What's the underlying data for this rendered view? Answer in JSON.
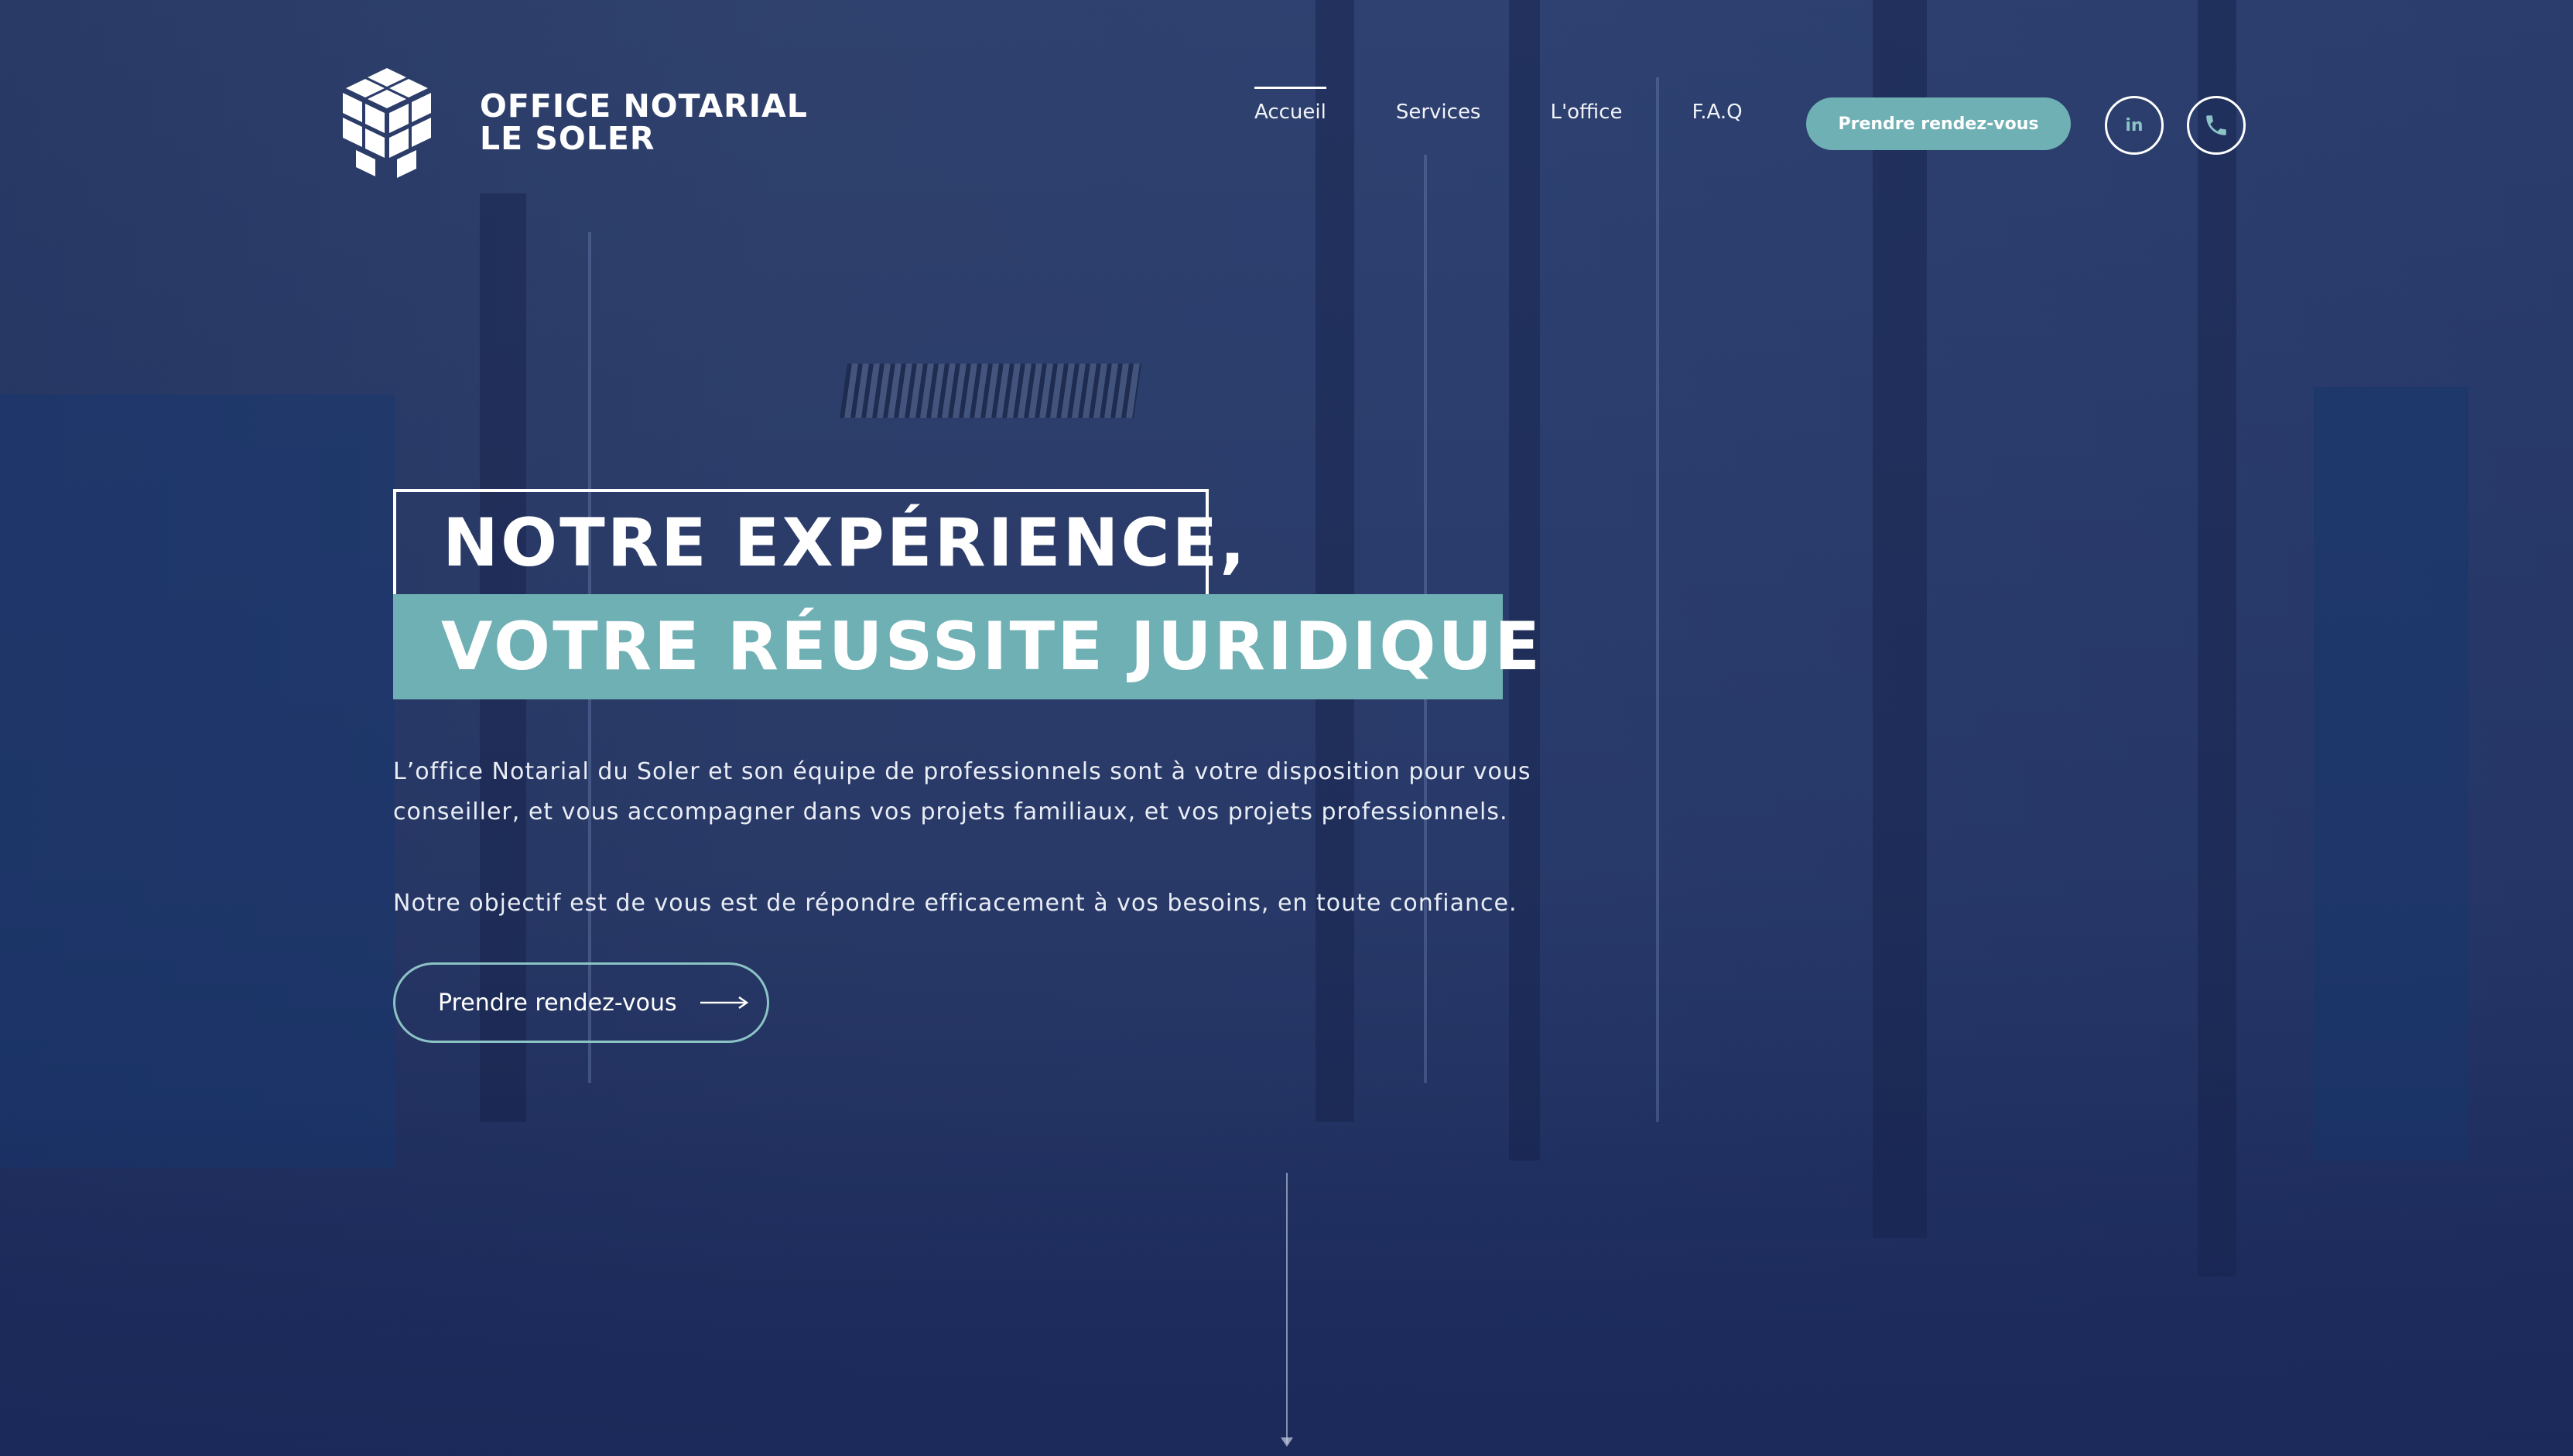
{
  "brand": {
    "line1": "OFFICE NOTARIAL",
    "line2": "LE SOLER"
  },
  "nav": {
    "items": [
      {
        "label": "Accueil",
        "active": true
      },
      {
        "label": "Services",
        "active": false
      },
      {
        "label": "L'office",
        "active": false
      },
      {
        "label": "F.A.Q",
        "active": false
      }
    ],
    "cta": "Prendre rendez-vous",
    "linkedin_icon": "in",
    "icons": [
      "linkedin-icon",
      "phone-icon"
    ]
  },
  "hero": {
    "headline_line1": "NOTRE EXPÉRIENCE,",
    "headline_line2": "VOTRE RÉUSSITE JURIDIQUE",
    "paragraph1": "L’office Notarial du Soler et son équipe de professionnels sont à votre disposition pour vous conseiller, et vous accompagner dans vos projets familiaux, et vos projets professionnels.",
    "paragraph2": "Notre objectif est de vous est de répondre efficacement à vos besoins, en toute confiance.",
    "cta": "Prendre rendez-vous"
  },
  "colors": {
    "accent": "#6fb0b4",
    "background": "#2d3f6e",
    "text": "#ffffff"
  }
}
